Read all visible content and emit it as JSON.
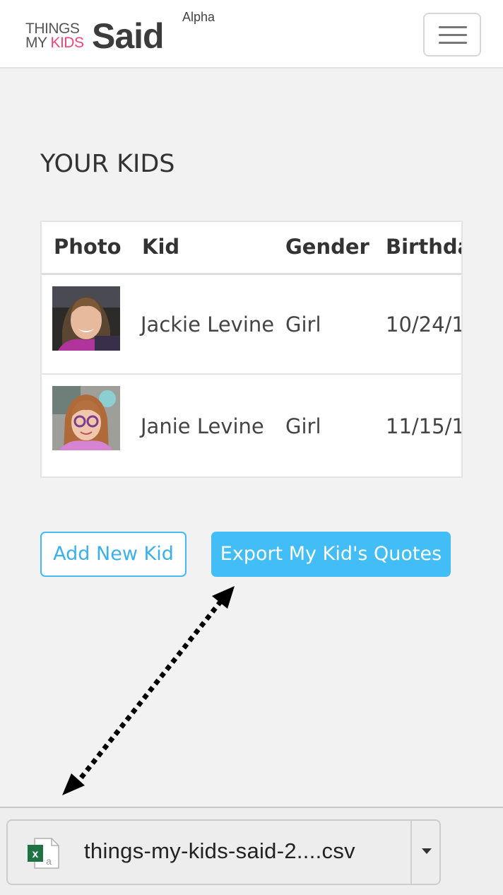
{
  "header": {
    "logo_line1": "THINGS",
    "logo_line2_a": "MY ",
    "logo_line2_b": "KIDS",
    "logo_big": "Said",
    "alpha": "Alpha",
    "menu_icon": "hamburger-icon"
  },
  "page": {
    "title": "YOUR KIDS"
  },
  "table": {
    "columns": [
      "Photo",
      "Kid",
      "Gender",
      "Birthda"
    ],
    "rows": [
      {
        "photo": "kid-photo",
        "name": "Jackie Levine",
        "gender": "Girl",
        "birthday": "10/24/1"
      },
      {
        "photo": "kid-photo",
        "name": "Janie Levine",
        "gender": "Girl",
        "birthday": "11/15/1"
      }
    ]
  },
  "buttons": {
    "add": "Add New Kid",
    "export": "Export My Kid's Quotes"
  },
  "download": {
    "file_icon": "excel-file-icon",
    "filename": "things-my-kids-said-2....csv",
    "menu_icon": "caret-down-icon"
  },
  "colors": {
    "accent": "#43bdf5",
    "logo_pink": "#f0457a",
    "background": "#f2f2f2"
  }
}
